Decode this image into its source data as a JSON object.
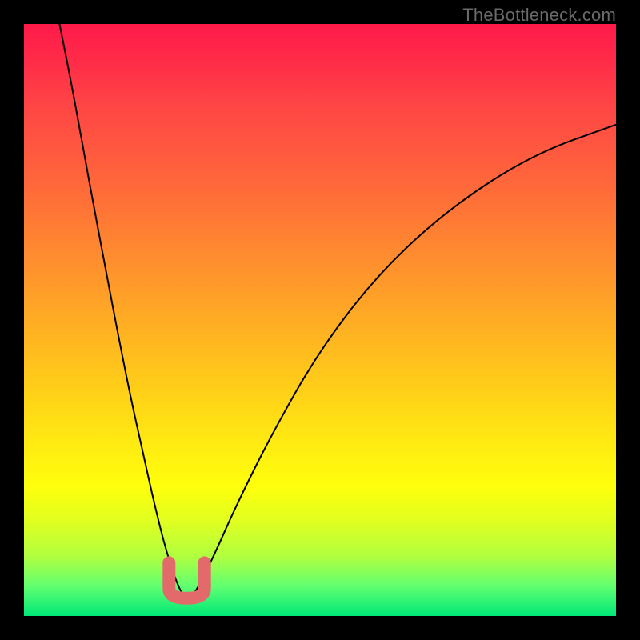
{
  "attribution": "TheBottleneck.com",
  "chart_data": {
    "type": "line",
    "title": "",
    "xlabel": "",
    "ylabel": "",
    "xlim": [
      0,
      100
    ],
    "ylim": [
      0,
      100
    ],
    "grid": false,
    "series": [
      {
        "name": "bottleneck-curve",
        "x": [
          6,
          8,
          10,
          12,
          14,
          16,
          18,
          20,
          22,
          24,
          26,
          27.5,
          29,
          32,
          36,
          42,
          50,
          60,
          72,
          86,
          100
        ],
        "values": [
          100,
          90,
          79,
          68,
          57.5,
          47,
          37,
          28,
          19,
          11,
          5,
          2.5,
          4,
          10,
          19,
          31,
          45,
          58,
          69,
          78,
          83
        ]
      }
    ],
    "marker_band": {
      "name": "optimal-range-marker",
      "x_range": [
        24.5,
        30.5
      ],
      "y_range": [
        3,
        9
      ],
      "color": "#e26a6a"
    },
    "background": {
      "type": "vertical-gradient",
      "top_color": "#ff1a4a",
      "mid_color": "#ffff0c",
      "bottom_color": "#00e878",
      "meaning": "red-high-bottleneck green-low-bottleneck"
    },
    "curve_color": "#000000"
  }
}
